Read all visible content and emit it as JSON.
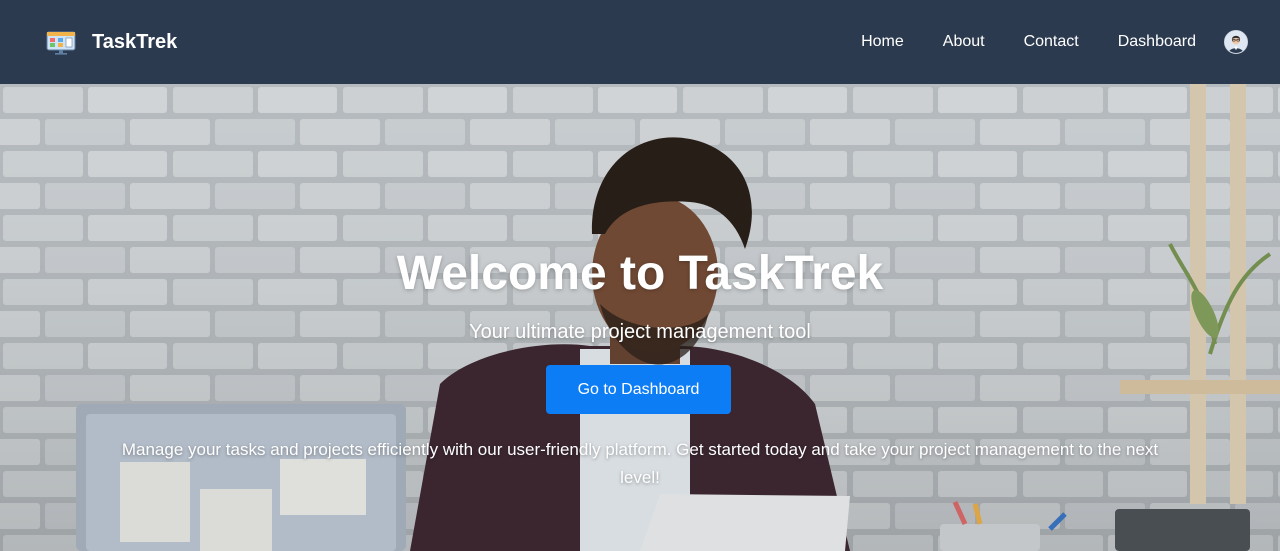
{
  "navbar": {
    "brand_name": "TaskTrek",
    "links": [
      {
        "label": "Home"
      },
      {
        "label": "About"
      },
      {
        "label": "Contact"
      },
      {
        "label": "Dashboard"
      }
    ],
    "background_color": "#2c3a4f"
  },
  "hero": {
    "title": "Welcome to TaskTrek",
    "subtitle": "Your ultimate project management tool",
    "cta_label": "Go to Dashboard",
    "description": "Manage your tasks and projects efficiently with our user-friendly platform. Get started today and take your project management to the next level!",
    "cta_color": "#0d7df6"
  },
  "icons": {
    "logo": "kanban-board-icon",
    "avatar": "user-avatar-icon"
  }
}
